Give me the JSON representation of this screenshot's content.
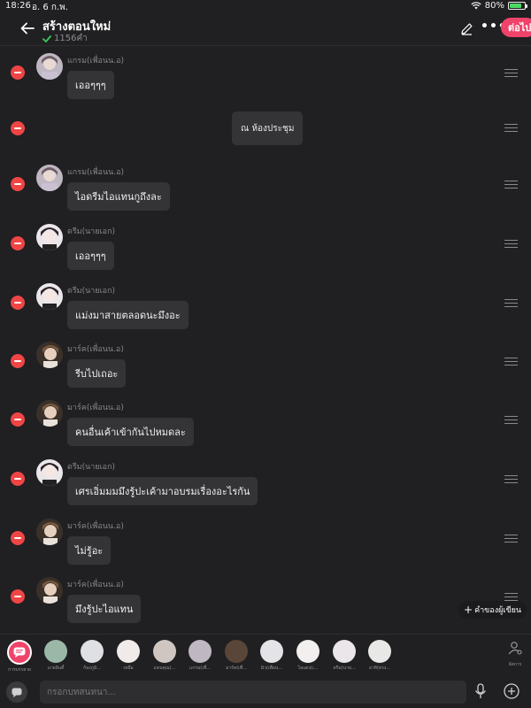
{
  "status": {
    "time": "18:26",
    "date": "อ. 6 ก.พ.",
    "battery": "80%",
    "battery_level": 0.8
  },
  "header": {
    "title": "สร้างตอนใหม่",
    "subtitle": "1156คำ",
    "next_label": "ต่อไป"
  },
  "messages": [
    {
      "name": "แกรม(เพื่อนน.อ)",
      "text": "เออๆๆๆ",
      "avatar": "avatar-gram"
    },
    {
      "text": "ณ ห้องประชุม"
    },
    {
      "name": "แกรม(เพื่อนน.อ)",
      "text": "ไอดรีมไอแทนกูถึงละ",
      "avatar": "avatar-gram"
    },
    {
      "name": "ดรีม(นายเอก)",
      "text": "เออๆๆๆ",
      "avatar": "avatar-dream"
    },
    {
      "name": "ดรีม(นายเอก)",
      "text": "แม่งมาสายตลอดนะมึงอะ",
      "avatar": "avatar-dream"
    },
    {
      "name": "มาร์ค(เพื่อนน.อ)",
      "text": "รีบไปเถอะ",
      "avatar": "avatar-mark"
    },
    {
      "name": "มาร์ค(เพื่อนน.อ)",
      "text": "คนอื่นเค้าเข้ากันไปหมดละ",
      "avatar": "avatar-mark"
    },
    {
      "name": "ดรีม(นายเอก)",
      "text": "เศรเอิ่มมมมึงรู้ปะเค้ามาอบรมเรื่องอะไรกัน",
      "avatar": "avatar-dream"
    },
    {
      "name": "มาร์ค(เพื่อนน.อ)",
      "text": "ไม่รู้อะ",
      "avatar": "avatar-mark"
    },
    {
      "name": "มาร์ค(เพื่อนน.อ)",
      "text": "มึงรู้ปะไอแทน",
      "avatar": "avatar-mark"
    }
  ],
  "add_writer_label": "คำของผู้เขียน",
  "characters": [
    {
      "label": "การบรรยาย"
    },
    {
      "label": "นายอินดี้"
    },
    {
      "label": "ก้องภูมิ..."
    },
    {
      "label": "เหมือ"
    },
    {
      "label": "แทนคุณ(..."
    },
    {
      "label": "แกรม(เพื่..."
    },
    {
      "label": "มาร์ค(เพื่..."
    },
    {
      "label": "มิว(เพื่อน..."
    },
    {
      "label": "ไอแดง(เ..."
    },
    {
      "label": "ดรีม(นาย..."
    },
    {
      "label": "อาทิ(ทรง..."
    }
  ],
  "manage_label": "จัดการ",
  "input": {
    "placeholder": "กรอกบทสนทนา..."
  },
  "colors": {
    "accent": "#f0436a",
    "delete": "#f04545",
    "background": "#202022",
    "bubble": "#343437"
  }
}
